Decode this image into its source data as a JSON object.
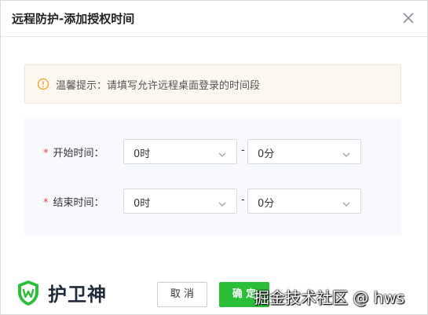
{
  "dialog": {
    "title": "远程防护-添加授权时间",
    "close_icon": "close-icon"
  },
  "tip": {
    "icon": "info-circle-icon",
    "text": "温馨提示：请填写允许远程桌面登录的时间段",
    "color": "#f0a020"
  },
  "form": {
    "required_mark": "*",
    "start": {
      "label": "开始时间：",
      "hour": "0时",
      "minute": "0分"
    },
    "end": {
      "label": "结束时间：",
      "hour": "0时",
      "minute": "0分"
    },
    "separator": "-"
  },
  "footer": {
    "brand": "护卫神",
    "cancel_label": "取 消",
    "ok_label": "确 定",
    "accent": "#2bbf38",
    "watermark": "掘金技术社区 @ hws"
  }
}
